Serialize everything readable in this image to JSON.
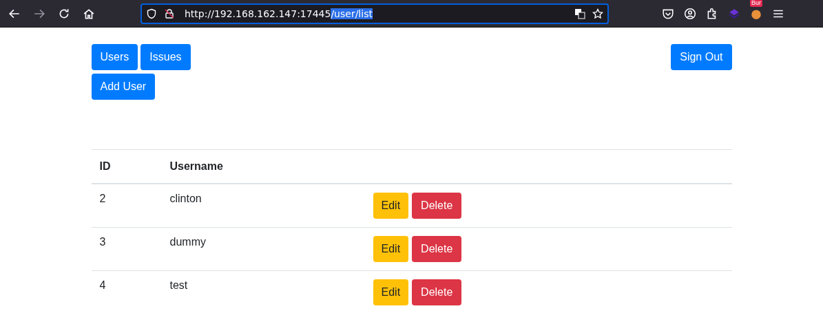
{
  "browser": {
    "back_disabled": false,
    "forward_disabled": true,
    "url_plain": "http://192.168.162.147:17445",
    "url_selected": "/user/list",
    "extension_badge": "Bur"
  },
  "nav": {
    "buttons": [
      "Users",
      "Issues"
    ],
    "sign_out": "Sign Out",
    "add_user": "Add User"
  },
  "table": {
    "columns": [
      "ID",
      "Username"
    ],
    "rows": [
      {
        "id": "2",
        "username": "clinton",
        "edit": "Edit",
        "delete": "Delete"
      },
      {
        "id": "3",
        "username": "dummy",
        "edit": "Edit",
        "delete": "Delete"
      },
      {
        "id": "4",
        "username": "test",
        "edit": "Edit",
        "delete": "Delete"
      }
    ]
  }
}
